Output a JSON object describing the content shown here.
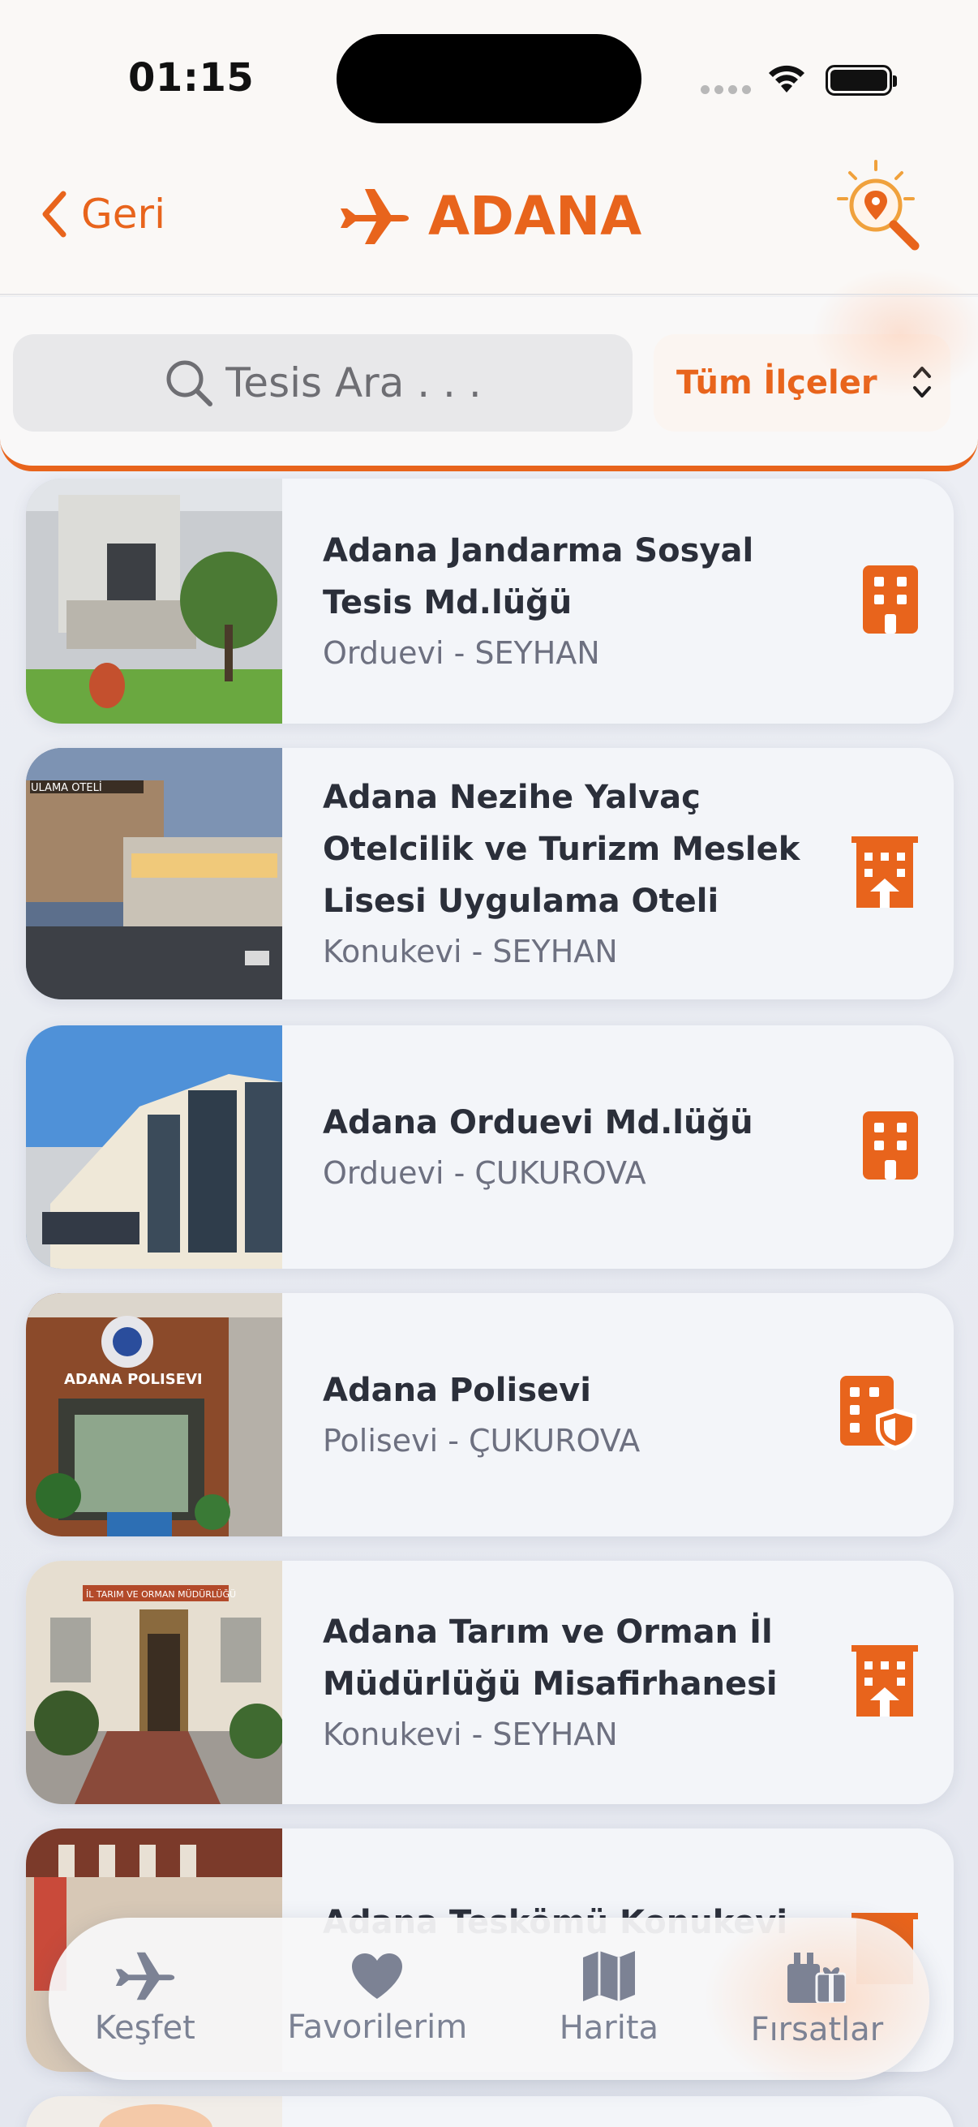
{
  "status_bar": {
    "time": "01:15"
  },
  "header": {
    "back_label": "Geri",
    "title": "ADANA"
  },
  "search": {
    "placeholder": "Tesis Ara . . .",
    "district_filter": "Tüm İlçeler"
  },
  "facilities": [
    {
      "name": "Adana Jandarma Sosyal Tesis Md.lüğü",
      "subtitle": "Orduevi - SEYHAN",
      "type_icon": "building-icon"
    },
    {
      "name": "Adana Nezihe Yalvaç Otelcilik ve Turizm Meslek Lisesi Uygulama Oteli",
      "subtitle": "Konukevi - SEYHAN",
      "type_icon": "hotel-icon"
    },
    {
      "name": "Adana Orduevi Md.lüğü",
      "subtitle": "Orduevi - ÇUKUROVA",
      "type_icon": "building-icon"
    },
    {
      "name": "Adana Polisevi",
      "subtitle": "Polisevi - ÇUKUROVA",
      "type_icon": "police-building-icon"
    },
    {
      "name": "Adana Tarım ve Orman İl Müdürlüğü Misafirhanesi",
      "subtitle": "Konukevi - SEYHAN",
      "type_icon": "hotel-icon"
    },
    {
      "name": "Adana Teskömü Konukevi",
      "subtitle": "",
      "type_icon": "hotel-icon"
    }
  ],
  "thumb_signs": {
    "hotel_sign": "ULAMA OTELİ",
    "police_sign": "ADANA POLISEVI",
    "agri_sign": "İL TARIM VE ORMAN MÜDÜRLÜĞÜ"
  },
  "tabs": [
    {
      "label": "Keşfet",
      "icon": "plane-icon"
    },
    {
      "label": "Favorilerim",
      "icon": "heart-icon"
    },
    {
      "label": "Harita",
      "icon": "map-icon"
    },
    {
      "label": "Fırsatlar",
      "icon": "gift-icon"
    }
  ],
  "colors": {
    "accent": "#e8641c",
    "card_bg": "#f3f5f9",
    "text_dark": "#2b2f3a",
    "text_muted": "#6d7080"
  }
}
